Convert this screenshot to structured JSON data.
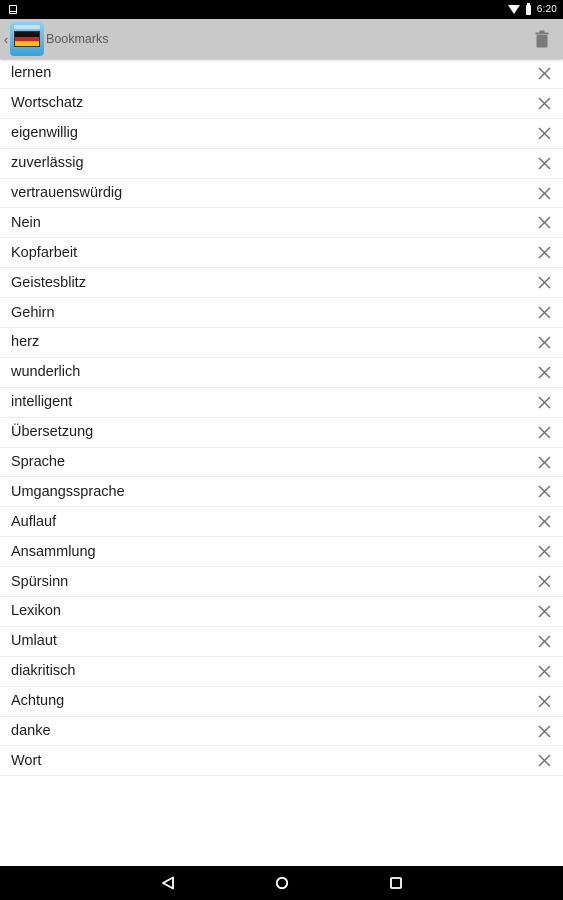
{
  "status_bar": {
    "time": "6:20",
    "icons": [
      "phone-notification-icon",
      "wifi-icon",
      "battery-icon"
    ]
  },
  "action_bar": {
    "title": "Bookmarks",
    "up_icon": "chevron-left-icon",
    "app_icon": "german-flag-app-icon",
    "action_icon": "trash-icon",
    "background": "#c9c9c9"
  },
  "bookmarks": [
    "lernen",
    "Wortschatz",
    "eigenwillig",
    "zuverlässig",
    "vertrauenswürdig",
    "Nein",
    "Kopfarbeit",
    "Geistesblitz",
    "Gehirn",
    "herz",
    "wunderlich",
    "intelligent",
    "Übersetzung",
    "Sprache",
    "Umgangssprache",
    "Auflauf",
    "Ansammlung",
    "Spürsinn",
    "Lexikon",
    "Umlaut",
    "diakritisch",
    "Achtung",
    "danke",
    "Wort"
  ],
  "nav_bar": {
    "icons": [
      "back-icon",
      "home-icon",
      "recents-icon"
    ]
  }
}
